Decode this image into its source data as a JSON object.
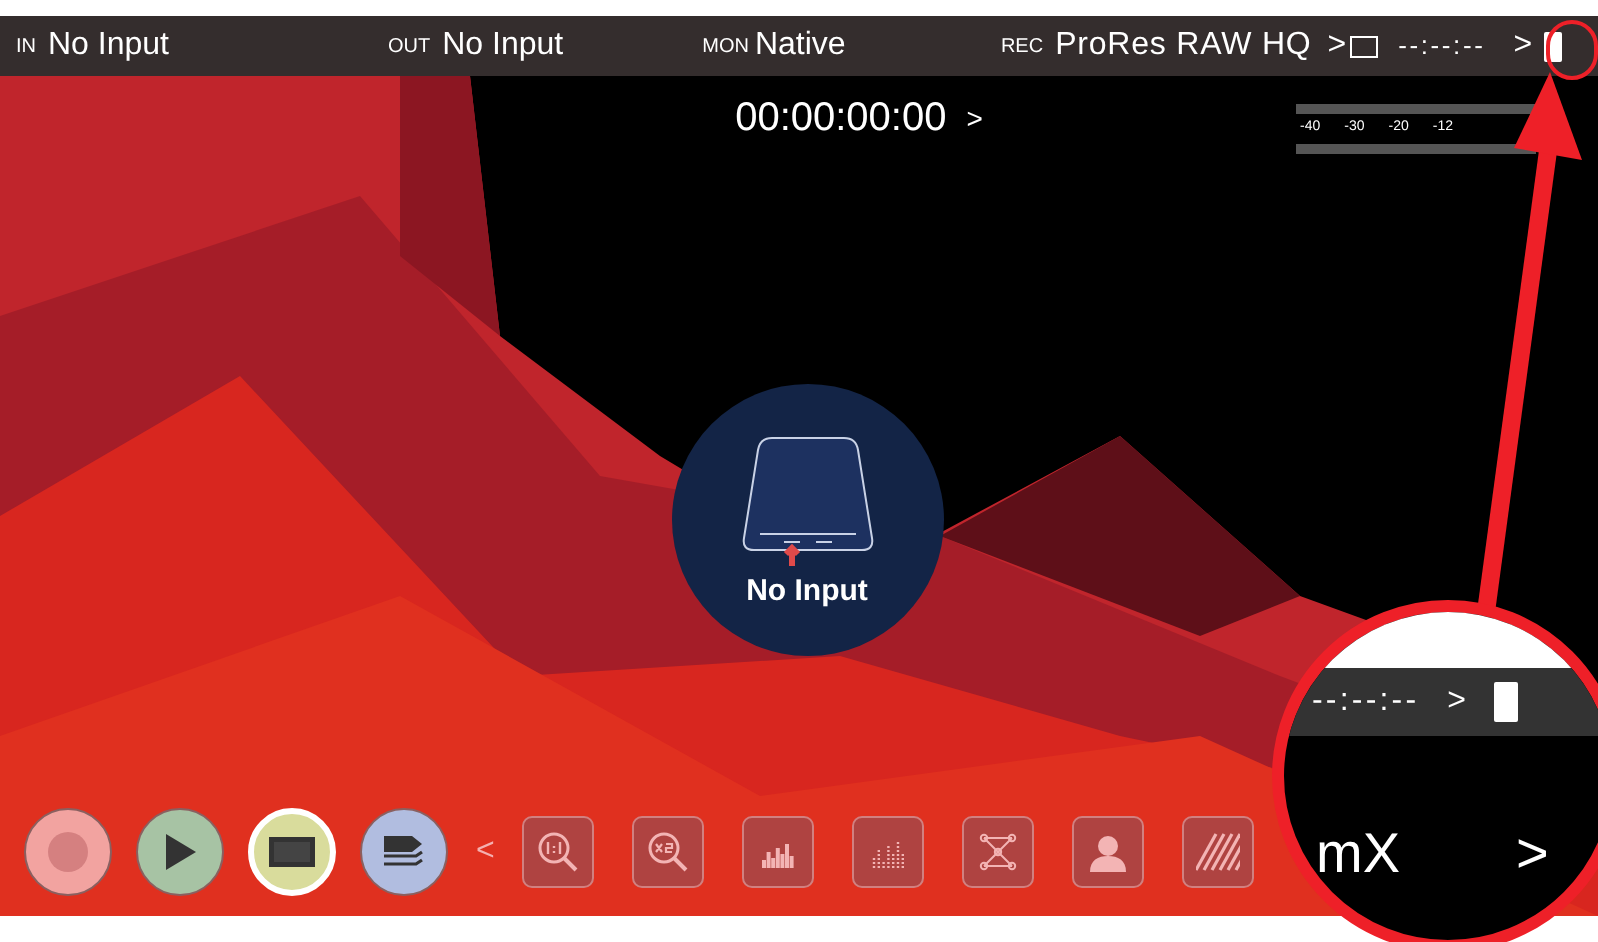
{
  "status_bar": {
    "input": {
      "label": "IN",
      "value": "No Input"
    },
    "output": {
      "label": "OUT",
      "value": "No Input"
    },
    "monitor": {
      "label": "MON",
      "value": "Native"
    },
    "record": {
      "label": "REC",
      "value": "ProRes RAW HQ",
      "chevron": ">"
    },
    "timecode": "--:--:--",
    "timecode_chevron": ">"
  },
  "timecode": {
    "value": "00:00:00:00",
    "chevron": ">"
  },
  "audio_meter": {
    "ticks": [
      "-40",
      "-30",
      "-20",
      "-12"
    ]
  },
  "no_input": {
    "label": "No Input"
  },
  "transport": [
    {
      "kind": "record",
      "selected": false
    },
    {
      "kind": "play",
      "selected": false
    },
    {
      "kind": "monitor",
      "selected": true
    },
    {
      "kind": "tag",
      "selected": false
    }
  ],
  "collapse_chevron": "<",
  "tools": [
    {
      "kind": "zoom-1-1"
    },
    {
      "kind": "zoom-2x"
    },
    {
      "kind": "histogram"
    },
    {
      "kind": "waveform"
    },
    {
      "kind": "vectorscope"
    },
    {
      "kind": "false-color"
    },
    {
      "kind": "zebra"
    }
  ],
  "zoom_callout": {
    "timecode": "--:--:--",
    "chevron": ">",
    "label": "mX",
    "chevron_2": ">"
  }
}
